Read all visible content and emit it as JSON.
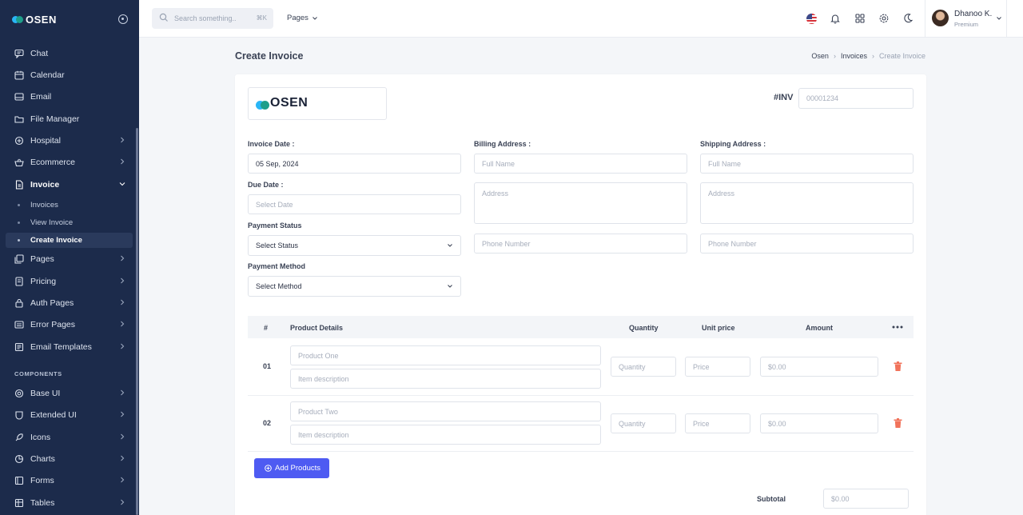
{
  "brand": {
    "name": "OSEN",
    "colors": {
      "dot1": "#29b6f6",
      "dot2": "#1e9e8a"
    }
  },
  "sidebar": {
    "items": [
      {
        "label": "Chat",
        "icon": "chat-icon",
        "has_chevron": false
      },
      {
        "label": "Calendar",
        "icon": "calendar-icon",
        "has_chevron": false
      },
      {
        "label": "Email",
        "icon": "email-icon",
        "has_chevron": false
      },
      {
        "label": "File Manager",
        "icon": "folder-icon",
        "has_chevron": false
      },
      {
        "label": "Hospital",
        "icon": "hospital-icon",
        "has_chevron": true
      },
      {
        "label": "Ecommerce",
        "icon": "basket-icon",
        "has_chevron": true
      },
      {
        "label": "Invoice",
        "icon": "invoice-icon",
        "has_chevron": true,
        "expanded": true
      }
    ],
    "invoice_sub": [
      {
        "label": "Invoices",
        "active": false
      },
      {
        "label": "View Invoice",
        "active": false
      },
      {
        "label": "Create Invoice",
        "active": true
      }
    ],
    "items2": [
      {
        "label": "Pages",
        "icon": "pages-icon"
      },
      {
        "label": "Pricing",
        "icon": "pricing-icon"
      },
      {
        "label": "Auth Pages",
        "icon": "lock-icon"
      },
      {
        "label": "Error Pages",
        "icon": "error-icon"
      },
      {
        "label": "Email Templates",
        "icon": "template-icon"
      }
    ],
    "section_label": "COMPONENTS",
    "components": [
      {
        "label": "Base UI",
        "icon": "base-ui-icon"
      },
      {
        "label": "Extended UI",
        "icon": "extended-ui-icon"
      },
      {
        "label": "Icons",
        "icon": "icons-icon"
      },
      {
        "label": "Charts",
        "icon": "chart-icon"
      },
      {
        "label": "Forms",
        "icon": "forms-icon"
      },
      {
        "label": "Tables",
        "icon": "table-icon"
      }
    ]
  },
  "topbar": {
    "search_placeholder": "Search something..",
    "search_shortcut": "⌘K",
    "pages_menu": "Pages",
    "user": {
      "name": "Dhanoo K.",
      "role": "Premium"
    }
  },
  "page": {
    "title": "Create Invoice",
    "breadcrumb": [
      "Osen",
      "Invoices",
      "Create Invoice"
    ]
  },
  "invoice": {
    "number_label": "#INV",
    "number_placeholder": "00001234",
    "invoice_date_label": "Invoice Date :",
    "invoice_date_value": "05 Sep, 2024",
    "due_date_label": "Due Date :",
    "due_date_placeholder": "Select Date",
    "payment_status_label": "Payment Status",
    "payment_status_value": "Select Status",
    "payment_method_label": "Payment Method",
    "payment_method_value": "Select Method",
    "billing": {
      "label": "Billing Address :",
      "name_ph": "Full Name",
      "address_ph": "Address",
      "phone_ph": "Phone Number"
    },
    "shipping": {
      "label": "Shipping Address :",
      "name_ph": "Full Name",
      "address_ph": "Address",
      "phone_ph": "Phone Number"
    },
    "table_headers": {
      "num": "#",
      "details": "Product Details",
      "qty": "Quantity",
      "price": "Unit price",
      "amount": "Amount"
    },
    "rows": [
      {
        "num": "01",
        "product_ph": "Product One",
        "desc_ph": "Item description",
        "qty_ph": "Quantity",
        "price_ph": "Price",
        "amount": "$0.00"
      },
      {
        "num": "02",
        "product_ph": "Product Two",
        "desc_ph": "Item description",
        "qty_ph": "Quantity",
        "price_ph": "Price",
        "amount": "$0.00"
      }
    ],
    "add_button": "Add Products",
    "subtotal_label": "Subtotal",
    "subtotal_value": "$0.00"
  }
}
